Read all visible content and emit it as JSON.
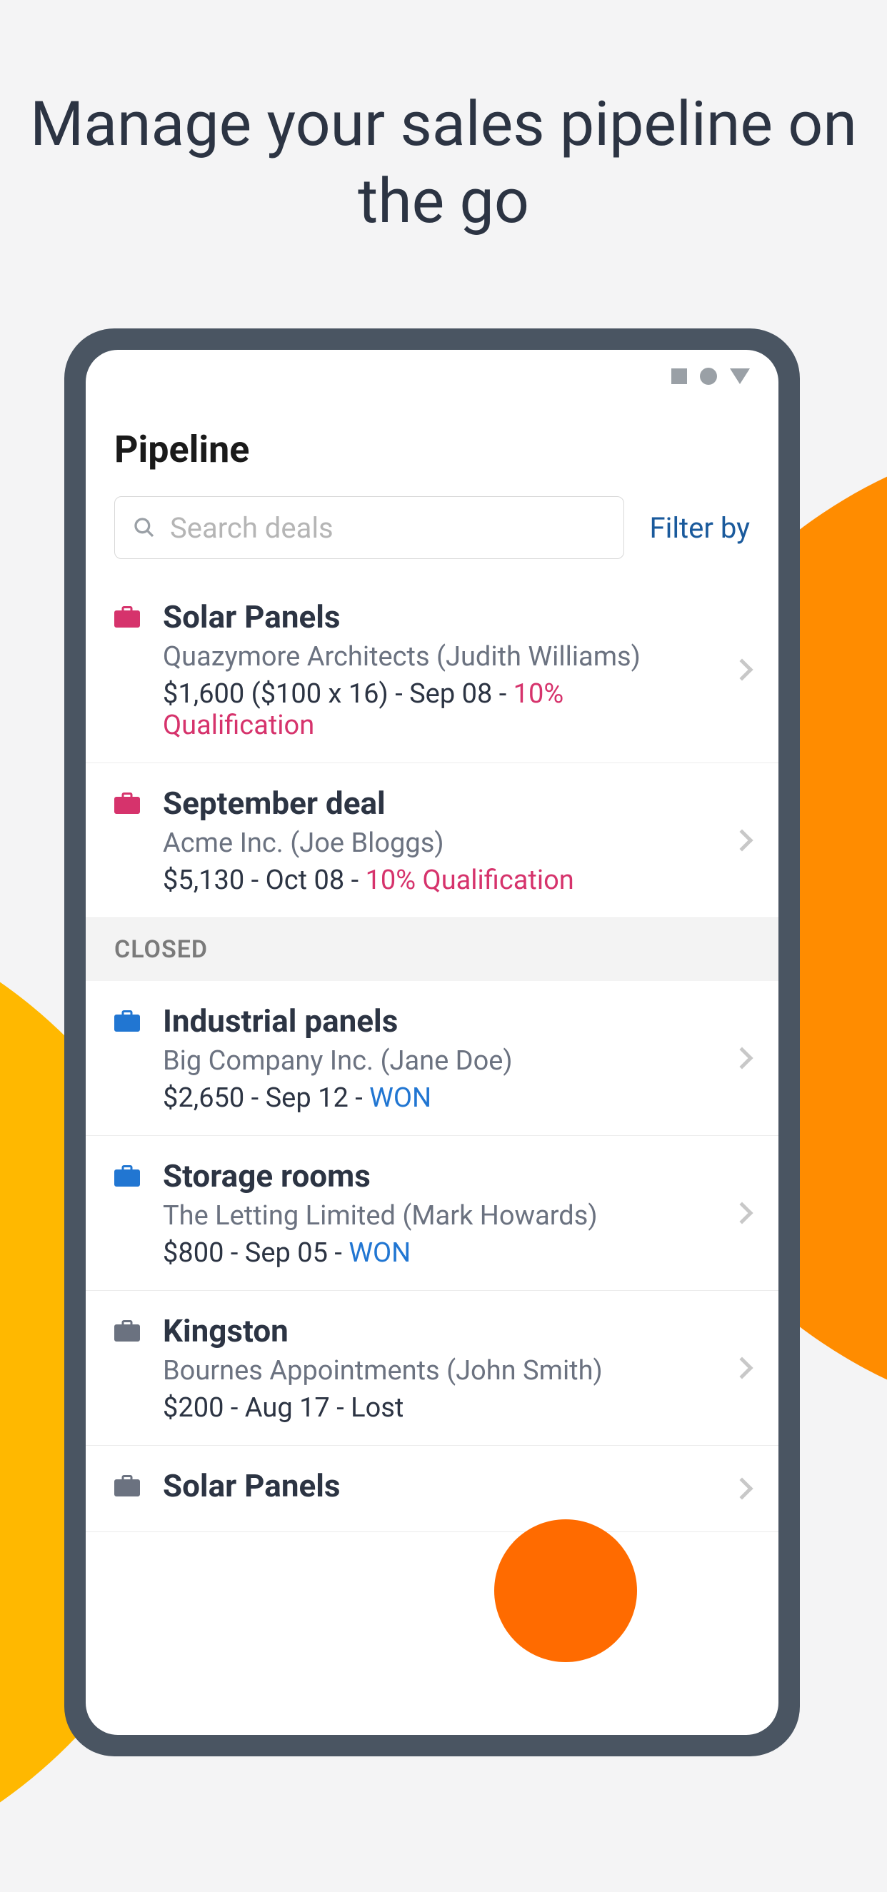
{
  "headline": "Manage your sales\npipeline on the go",
  "screen": {
    "title": "Pipeline",
    "search_placeholder": "Search deals",
    "filter_label": "Filter by"
  },
  "section_closed": "CLOSED",
  "deals_open": [
    {
      "title": "Solar Panels",
      "company": "Quazymore Architects (Judith Williams)",
      "meta_prefix": "$1,600 ($100 x 16) - Sep 08 - ",
      "status": "10% Qualification",
      "status_color": "pink",
      "icon_color": "#d6336c"
    },
    {
      "title": "September deal",
      "company": "Acme Inc. (Joe Bloggs)",
      "meta_prefix": "$5,130 - Oct 08 - ",
      "status": "10% Qualification",
      "status_color": "pink",
      "icon_color": "#d6336c"
    }
  ],
  "deals_closed": [
    {
      "title": "Industrial panels",
      "company": "Big Company Inc. (Jane Doe)",
      "meta_prefix": "$2,650 - Sep 12 - ",
      "status": "WON",
      "status_color": "blue",
      "icon_color": "#2176d2"
    },
    {
      "title": "Storage rooms",
      "company": "The Letting Limited (Mark Howards)",
      "meta_prefix": "$800 - Sep 05 - ",
      "status": "WON",
      "status_color": "blue",
      "icon_color": "#2176d2"
    },
    {
      "title": "Kingston",
      "company": "Bournes Appointments (John Smith)",
      "meta_prefix": "$200 - Aug 17 - Lost",
      "status": "",
      "status_color": "",
      "icon_color": "#6b7280"
    },
    {
      "title": "Solar Panels",
      "company": "",
      "meta_prefix": "",
      "status": "",
      "status_color": "",
      "icon_color": "#6b7280"
    }
  ]
}
